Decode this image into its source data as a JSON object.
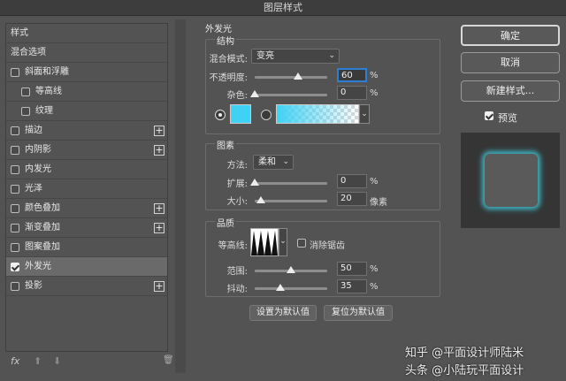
{
  "window": {
    "title": "图层样式"
  },
  "sidebar": {
    "header": "样式",
    "items": [
      {
        "label": "混合选项",
        "checkbox": false,
        "plus": false,
        "checked": false,
        "indent": 0
      },
      {
        "label": "斜面和浮雕",
        "checkbox": true,
        "plus": false,
        "checked": false,
        "indent": 0
      },
      {
        "label": "等高线",
        "checkbox": true,
        "plus": false,
        "checked": false,
        "indent": 1
      },
      {
        "label": "纹理",
        "checkbox": true,
        "plus": false,
        "checked": false,
        "indent": 1
      },
      {
        "label": "描边",
        "checkbox": true,
        "plus": true,
        "checked": false,
        "indent": 0
      },
      {
        "label": "内阴影",
        "checkbox": true,
        "plus": true,
        "checked": false,
        "indent": 0
      },
      {
        "label": "内发光",
        "checkbox": true,
        "plus": false,
        "checked": false,
        "indent": 0
      },
      {
        "label": "光泽",
        "checkbox": true,
        "plus": false,
        "checked": false,
        "indent": 0
      },
      {
        "label": "颜色叠加",
        "checkbox": true,
        "plus": true,
        "checked": false,
        "indent": 0
      },
      {
        "label": "渐变叠加",
        "checkbox": true,
        "plus": true,
        "checked": false,
        "indent": 0
      },
      {
        "label": "图案叠加",
        "checkbox": true,
        "plus": false,
        "checked": false,
        "indent": 0
      },
      {
        "label": "外发光",
        "checkbox": true,
        "plus": false,
        "checked": true,
        "indent": 0,
        "selected": true
      },
      {
        "label": "投影",
        "checkbox": true,
        "plus": true,
        "checked": false,
        "indent": 0
      }
    ],
    "footer": {
      "fx": "fx",
      "up": "⬆",
      "down": "⬇",
      "trash": "🗑"
    }
  },
  "panel": {
    "title": "外发光",
    "structure": {
      "title": "结构",
      "blend_label": "混合模式:",
      "blend_value": "变亮",
      "opacity_label": "不透明度:",
      "opacity_value": "60",
      "opacity_level": 0.6,
      "noise_label": "杂色:",
      "noise_value": "0",
      "noise_level": 0,
      "percent": "%",
      "glow_color": "#3fd2f5"
    },
    "elements": {
      "title": "图素",
      "method_label": "方法:",
      "method_value": "柔和",
      "spread_label": "扩展:",
      "spread_value": "0",
      "spread_level": 0,
      "size_label": "大小:",
      "size_value": "20",
      "size_level": 0.08,
      "size_unit": "像素",
      "percent": "%"
    },
    "quality": {
      "title": "品质",
      "contour_label": "等高线:",
      "antialias_label": "消除锯齿",
      "range_label": "范围:",
      "range_value": "50",
      "range_level": 0.5,
      "jitter_label": "抖动:",
      "jitter_value": "35",
      "jitter_level": 0.35,
      "percent": "%"
    },
    "buttons": {
      "set_default": "设置为默认值",
      "reset_default": "复位为默认值"
    }
  },
  "right": {
    "ok": "确定",
    "cancel": "取消",
    "new_style": "新建样式...",
    "preview_label": "预览",
    "preview_checked": true
  },
  "watermark": {
    "line1": "知乎 @平面设计师陆米",
    "line2": "头条 @小陆玩平面设计"
  }
}
